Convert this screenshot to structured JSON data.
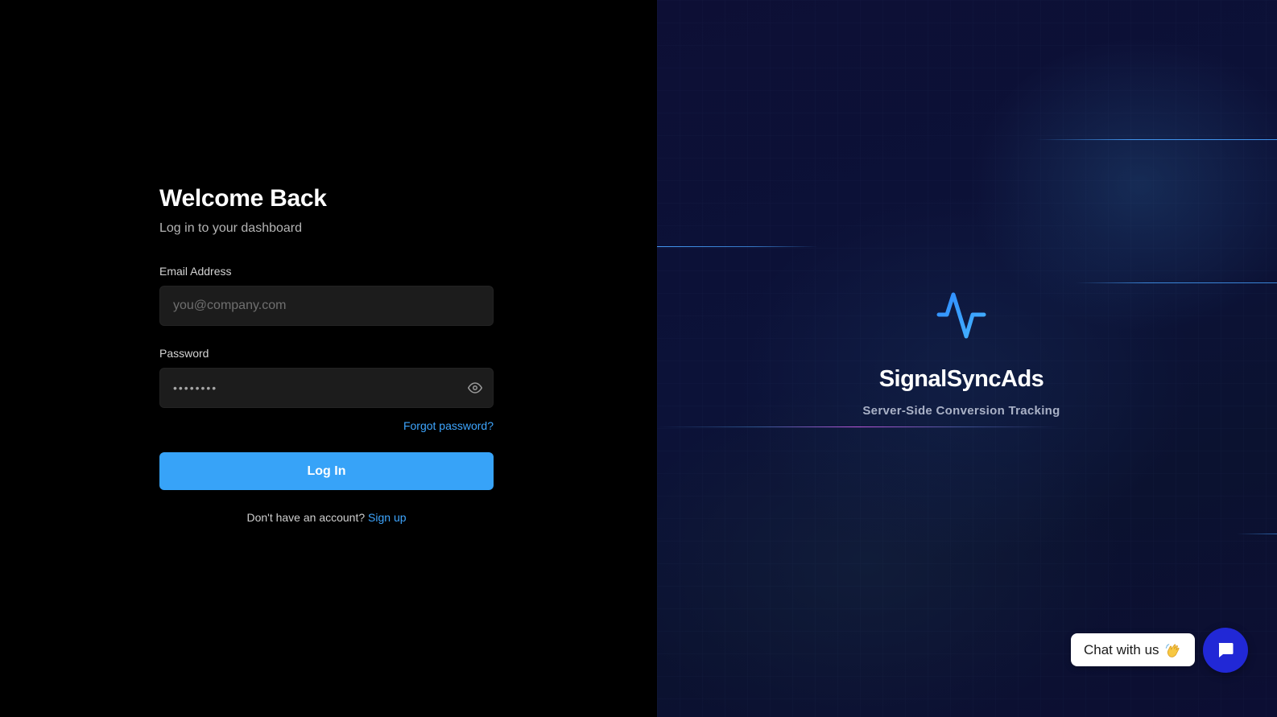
{
  "login": {
    "title": "Welcome Back",
    "subtitle": "Log in to your dashboard",
    "email": {
      "label": "Email Address",
      "placeholder": "you@company.com",
      "value": ""
    },
    "password": {
      "label": "Password",
      "value": "••••••••",
      "toggle_icon": "eye-icon"
    },
    "forgot_password": "Forgot password?",
    "submit_label": "Log In",
    "signup_prompt": "Don't have an account?",
    "signup_link": "Sign up"
  },
  "brand": {
    "icon": "pulse-activity-icon",
    "name": "SignalSyncAds",
    "tagline": "Server-Side Conversion Tracking"
  },
  "chat_widget": {
    "label": "Chat with us",
    "emoji_icon": "waving-hand-icon",
    "launcher_icon": "chat-bubble-icon"
  },
  "colors": {
    "accent": "#37a3f8",
    "link": "#3ea6ff",
    "left_background": "#000000",
    "right_background": "#0c1238",
    "chat_launcher": "#2128d6"
  }
}
